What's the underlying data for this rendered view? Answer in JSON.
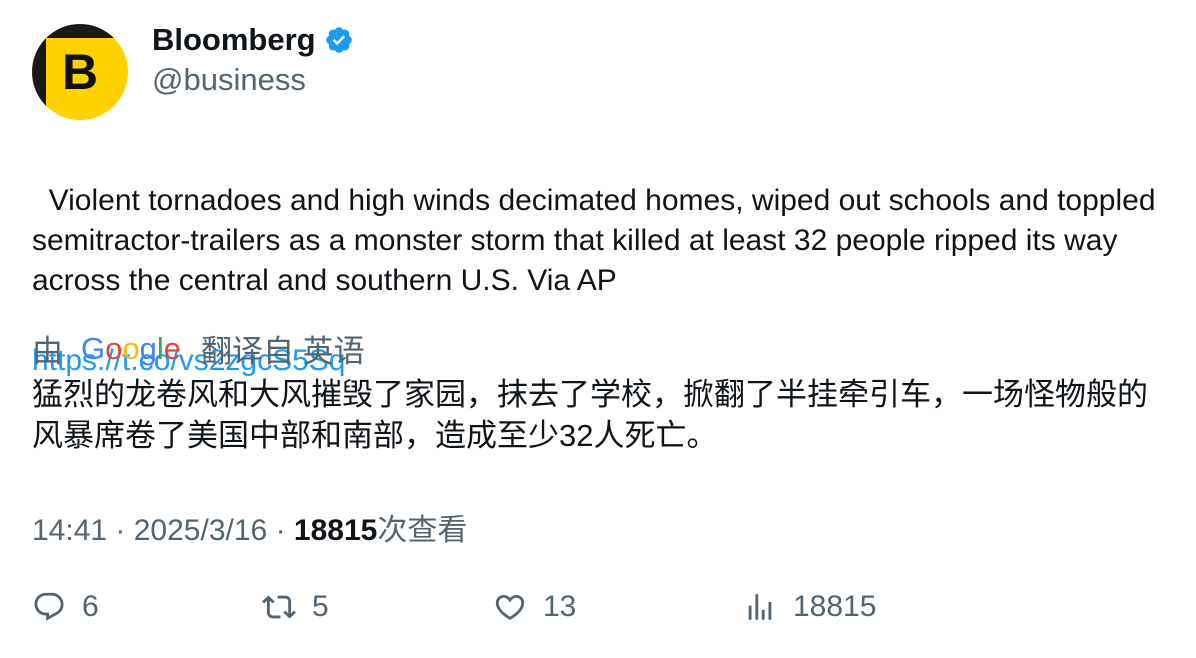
{
  "author": {
    "name": "Bloomberg",
    "handle": "@business",
    "avatar_letter": "B",
    "verified": true,
    "avatar_color": "#ffd200"
  },
  "tweet": {
    "text": "Violent tornadoes and high winds decimated homes, wiped out schools and toppled semitractor-trailers as a monster storm that killed at least 32 people ripped its way across the central and southern U.S. Via AP",
    "link": "https://t.co/vs2zgcS5Sq"
  },
  "translation": {
    "by_label": "由",
    "provider": "Google",
    "from_label": "翻译自 英语",
    "text": "猛烈的龙卷风和大风摧毁了家园，抹去了学校，掀翻了半挂牵引车，一场怪物般的风暴席卷了美国中部和南部，造成至少32人死亡。"
  },
  "meta": {
    "time": "14:41",
    "separator": "·",
    "date": "2025/3/16",
    "views_count": "18815",
    "views_label": "次查看"
  },
  "actions": {
    "replies": "6",
    "retweets": "5",
    "likes": "13",
    "views": "18815"
  },
  "colors": {
    "link": "#1d9bf0",
    "secondary": "#536471",
    "verified_badge": "#1d9bf0"
  }
}
